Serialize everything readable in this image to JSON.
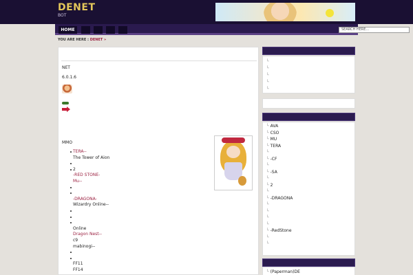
{
  "header": {
    "logo": "DENET",
    "tagline": "BOT"
  },
  "nav": {
    "home_label": "HOME",
    "search_placeholder": "SEARCH HERE..."
  },
  "breadcrumb": {
    "prefix": "YOU ARE HERE :",
    "current": "DENET »"
  },
  "main": {
    "line1": "NET",
    "version": "6.0.1.6",
    "mmo": "MMO",
    "list": [
      {
        "text": "TERA--",
        "link": true,
        "bullet": true
      },
      {
        "text": "The Tower of Aion",
        "link": false,
        "bullet": false
      },
      {
        "text": "",
        "link": false,
        "bullet": true
      },
      {
        "text": "2",
        "link": false,
        "bullet": true
      },
      {
        "text": "-RED STONE-",
        "link": true,
        "bullet": false
      },
      {
        "text": "Mu--",
        "link": true,
        "bullet": false
      },
      {
        "text": "",
        "link": false,
        "bullet": true
      },
      {
        "text": "",
        "link": false,
        "bullet": true
      },
      {
        "text": "-DRAGONA-",
        "link": true,
        "bullet": false
      },
      {
        "text": "Wizardry Online--",
        "link": false,
        "bullet": false
      },
      {
        "text": "",
        "link": false,
        "bullet": true
      },
      {
        "text": "",
        "link": false,
        "bullet": true
      },
      {
        "text": "",
        "link": false,
        "bullet": true
      },
      {
        "text": "Online",
        "link": false,
        "bullet": false
      },
      {
        "text": "Dragon Nest--",
        "link": true,
        "bullet": false
      },
      {
        "text": "c9",
        "link": false,
        "bullet": false
      },
      {
        "text": "mabinogi--",
        "link": false,
        "bullet": false
      },
      {
        "text": "",
        "link": false,
        "bullet": true
      },
      {
        "text": "",
        "link": false,
        "bullet": true
      },
      {
        "text": "FF11",
        "link": false,
        "bullet": false
      },
      {
        "text": "FF14",
        "link": false,
        "bullet": false
      }
    ]
  },
  "sidebar": {
    "box1_items": [
      "",
      "",
      "",
      "",
      ""
    ],
    "box2_items": [
      "AVA",
      "CSO",
      "MU",
      "TERA",
      "",
      "-CF",
      "",
      "-SA",
      "",
      "2",
      "",
      "-DRAGONA",
      "",
      "",
      "",
      "",
      "-RedStone",
      "",
      ""
    ],
    "box3_items": [
      "(Paperman)DE"
    ]
  },
  "colors": {
    "header_bg": "#1a1033",
    "logo": "#e3c65a",
    "nav_bg": "#2a1a4e",
    "link": "#9b2040",
    "page_bg": "#e4e1dc"
  }
}
